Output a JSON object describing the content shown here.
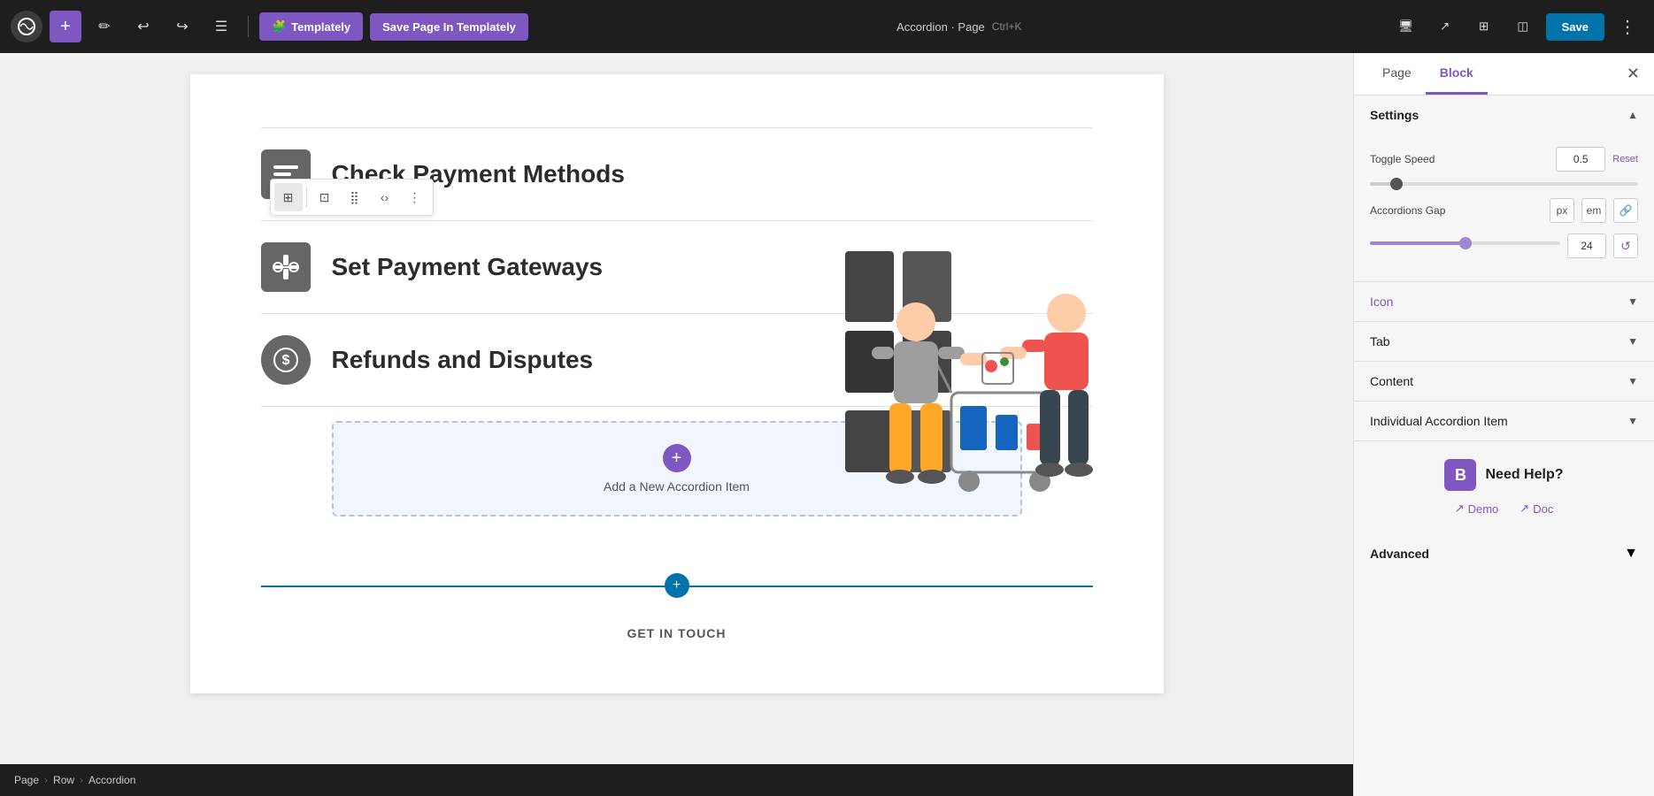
{
  "toolbar": {
    "templately_label": "Templately",
    "save_in_templately_label": "Save Page In Templately",
    "page_name": "Accordion · Page",
    "shortcut": "Ctrl+K",
    "save_label": "Save"
  },
  "block_toolbar": {
    "btn1": "⊞",
    "btn2": "⊡",
    "btn3": "⣿",
    "btn4": "‹›",
    "btn5": "⋮"
  },
  "accordion": {
    "items": [
      {
        "icon": "≡",
        "title": "Check Payment Methods"
      },
      {
        "icon": "⟐",
        "title": "Set Payment Gateways"
      },
      {
        "icon": "$",
        "title": "Refunds and Disputes"
      }
    ],
    "add_button_label": "Add a New Accordion Item"
  },
  "get_in_touch": "GET IN TOUCH",
  "breadcrumb": {
    "items": [
      "Page",
      "Row",
      "Accordion"
    ]
  },
  "sidebar": {
    "tab_page": "Page",
    "tab_block": "Block",
    "settings_title": "Settings",
    "toggle_speed_label": "Toggle Speed",
    "toggle_speed_value": "0.5",
    "reset_label": "Reset",
    "accordions_gap_label": "Accordions Gap",
    "accordions_gap_value": "24",
    "icon_label": "Icon",
    "tab_label": "Tab",
    "content_label": "Content",
    "individual_accordion_label": "Individual Accordion Item",
    "need_help_title": "Need Help?",
    "demo_label": "Demo",
    "doc_label": "Doc",
    "advanced_label": "Advanced"
  }
}
